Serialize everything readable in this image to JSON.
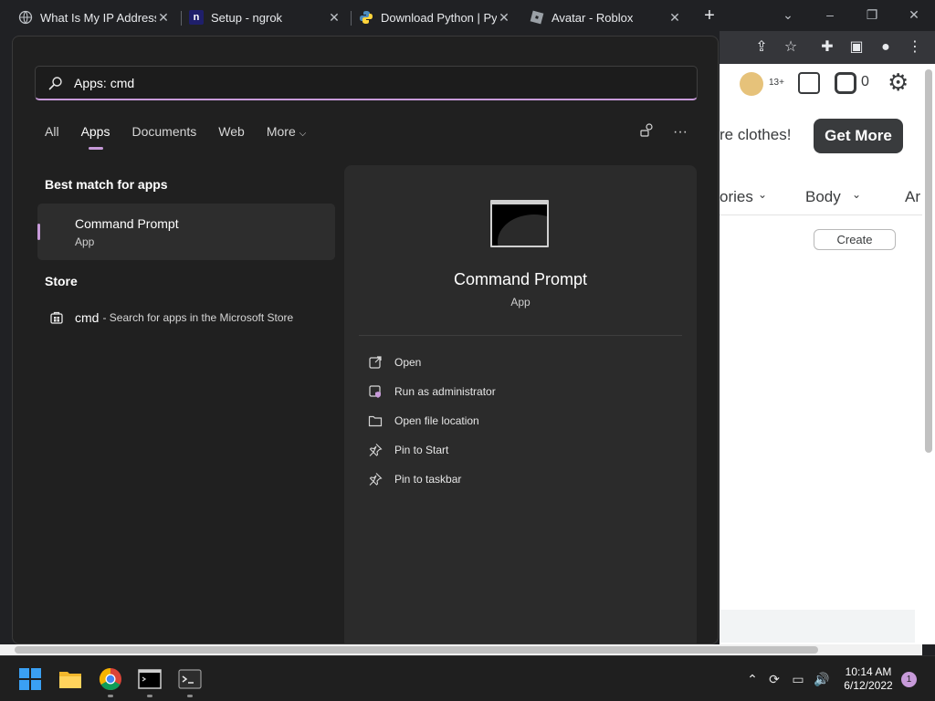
{
  "browser": {
    "tabs": [
      {
        "title": "What Is My IP Address",
        "favicon": "globe-icon"
      },
      {
        "title": "Setup - ngrok",
        "favicon": "ngrok-icon"
      },
      {
        "title": "Download Python | Py",
        "favicon": "python-icon"
      },
      {
        "title": "Avatar - Roblox",
        "favicon": "roblox-icon"
      }
    ],
    "new_tab": "+",
    "toolbar_icons": [
      "share-icon",
      "star-icon",
      "extensions-icon",
      "sidepanel-icon",
      "profile-icon",
      "kebab-menu-icon"
    ]
  },
  "roblox": {
    "age_badge": "13+",
    "robux_count": "0",
    "banner_text": "re clothes!",
    "get_more": "Get More",
    "categories": [
      {
        "label": "ories"
      },
      {
        "label": "Body"
      },
      {
        "label": "Ar"
      }
    ],
    "create": "Create"
  },
  "start_search": {
    "search_value": "Apps: cmd",
    "filter_tabs": [
      {
        "label": "All"
      },
      {
        "label": "Apps"
      },
      {
        "label": "Documents"
      },
      {
        "label": "Web"
      },
      {
        "label": "More"
      }
    ],
    "active_tab": "Apps",
    "best_match_heading": "Best match for apps",
    "best_match": {
      "title": "Command Prompt",
      "subtitle": "App"
    },
    "store_heading": "Store",
    "store_item": {
      "query": "cmd",
      "rest": "- Search for apps in the Microsoft Store"
    },
    "detail": {
      "title": "Command Prompt",
      "type": "App",
      "actions": [
        {
          "label": "Open",
          "icon": "open-icon"
        },
        {
          "label": "Run as administrator",
          "icon": "admin-shield-icon"
        },
        {
          "label": "Open file location",
          "icon": "folder-icon"
        },
        {
          "label": "Pin to Start",
          "icon": "pin-icon"
        },
        {
          "label": "Pin to taskbar",
          "icon": "pin-icon"
        }
      ]
    }
  },
  "taskbar": {
    "apps": [
      "windows-start-icon",
      "file-explorer-icon",
      "chrome-icon",
      "cmd-icon",
      "terminal-icon"
    ],
    "time": "10:14 AM",
    "date": "6/12/2022",
    "notifications": "1"
  },
  "colors": {
    "accent": "#c79ad9",
    "flyout_bg": "#202020",
    "taskbar_bg": "#1f1f1f"
  }
}
